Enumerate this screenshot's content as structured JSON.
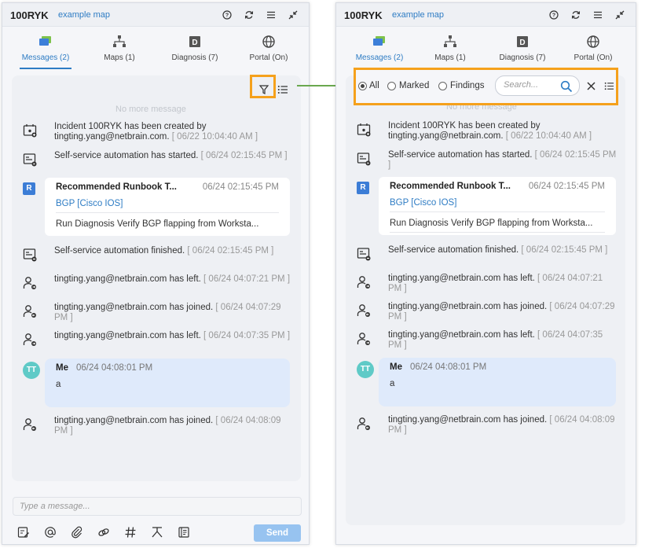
{
  "header": {
    "title": "100RYK",
    "subtitle": "example map"
  },
  "tabs": [
    {
      "label": "Messages (2)"
    },
    {
      "label": "Maps (1)"
    },
    {
      "label": "Diagnosis (7)"
    },
    {
      "label": "Portal (On)"
    }
  ],
  "no_more": "No more message",
  "messages": [
    {
      "text": "Incident 100RYK has been created by tingting.yang@netbrain.com.",
      "ts": "[ 06/22 10:04:40 AM ]"
    },
    {
      "text": "Self-service automation has started.",
      "ts": "[ 06/24 02:15:45 PM ]"
    },
    {
      "text": "Self-service automation finished.",
      "ts": "[ 06/24 02:15:45 PM ]"
    },
    {
      "text": "tingting.yang@netbrain.com has left.",
      "ts": "[ 06/24 04:07:21 PM ]"
    },
    {
      "text": "tingting.yang@netbrain.com has joined.",
      "ts": "[ 06/24 04:07:29 PM ]"
    },
    {
      "text": "tingting.yang@netbrain.com has left.",
      "ts": "[ 06/24 04:07:35 PM ]"
    },
    {
      "text": "tingting.yang@netbrain.com has joined.",
      "ts": "[ 06/24 04:08:09 PM ]"
    }
  ],
  "runbook": {
    "badge": "R",
    "title": "Recommended Runbook T...",
    "ts": "06/24 02:15:45 PM",
    "link": "BGP [Cisco IOS]",
    "desc": "Run Diagnosis Verify BGP flapping from Worksta..."
  },
  "me": {
    "avatar": "TT",
    "name": "Me",
    "ts": "06/24 04:08:01 PM",
    "text": "a"
  },
  "input": {
    "placeholder": "Type a message..."
  },
  "send_label": "Send",
  "filter": {
    "all": "All",
    "marked": "Marked",
    "findings": "Findings",
    "search_placeholder": "Search..."
  },
  "colors": {
    "accent": "#2e7cc4",
    "highlight": "#f5a11c",
    "arrow": "#6aa84f",
    "send": "#97c3f0"
  }
}
